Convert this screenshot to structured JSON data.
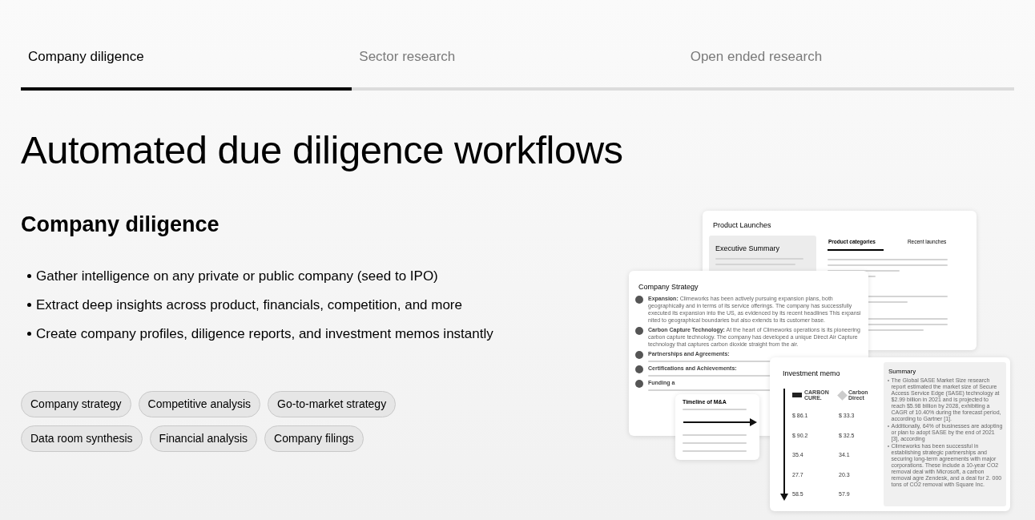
{
  "tabs": [
    {
      "label": "Company diligence",
      "selected": true
    },
    {
      "label": "Sector research",
      "selected": false
    },
    {
      "label": "Open ended research",
      "selected": false
    }
  ],
  "heading": "Automated due diligence workflows",
  "section": {
    "title": "Company diligence",
    "bullets": [
      "Gather intelligence on any private or public company (seed to IPO)",
      "Extract deep insights across product, financials, competition, and more",
      "Create company profiles, diligence reports, and investment memos instantly"
    ]
  },
  "tags": [
    "Company strategy",
    "Competitive analysis",
    "Go-to-market strategy",
    "Data room synthesis",
    "Financial analysis",
    "Company filings"
  ],
  "preview": {
    "product_launches": {
      "title": "Product Launches",
      "summary_title": "Executive Summary",
      "tabs": [
        {
          "label": "Product categories",
          "selected": true
        },
        {
          "label": "Recent launches",
          "selected": false
        }
      ]
    },
    "company_strategy": {
      "title": "Company Strategy",
      "items": [
        {
          "title": "Expansion:",
          "text": "Climeworks has been actively pursuing expansion plans, both geographically and in terms of its service offerings. The company has successfully executed its expansion into the US, as evidenced by its recent headlines This expansi nited to geographical boundaries but also extends to its customer base."
        },
        {
          "title": "Carbon Capture Technology:",
          "text": "At the heart of Climeworks operations is its pioneering carbon capture technology. The company has developed a unique Direct Air Capture technology that captures carbon dioxide straight from the air."
        },
        {
          "title": "Partnerships and Agreements:"
        },
        {
          "title": "Certifications and Achievements:"
        },
        {
          "title": "Funding a"
        }
      ]
    },
    "timeline": {
      "title": "Timeline of M&A"
    },
    "investment_memo": {
      "title": "Investment memo",
      "companies": [
        "CARBON CURE.",
        "Carbon Direct"
      ],
      "rows": [
        [
          "$ 86.1",
          "$ 33.3"
        ],
        [
          "$ 90.2",
          "$ 32.5"
        ],
        [
          "35.4",
          "34.1"
        ],
        [
          "27.7",
          "20.3"
        ],
        [
          "58.5",
          "57.9"
        ]
      ],
      "summary": {
        "title": "Summary",
        "bullets": [
          "The Global SASE Market Size research report estimated the market size of Secure Access Service Edge (SASE) technology at $2.99 billion in 2021 and is projected to reach $5.98 billion by 2028, exhibiting a CAGR of 10.40% during the forecast period, according to Gartner [1].",
          "Additionally, 64% of businesses are adopting or plan to adopt SASE by the end of 2021 [3], according",
          "Climeworks has been successful in establishing strategic partnerships and securing long-term agreements with major corporations. These include a 10-year CO2 removal deal with Microsoft, a carbon removal agre Zendesk, and a deal for 2. 000 tons of CO2 removal with Square Inc."
        ]
      }
    }
  }
}
